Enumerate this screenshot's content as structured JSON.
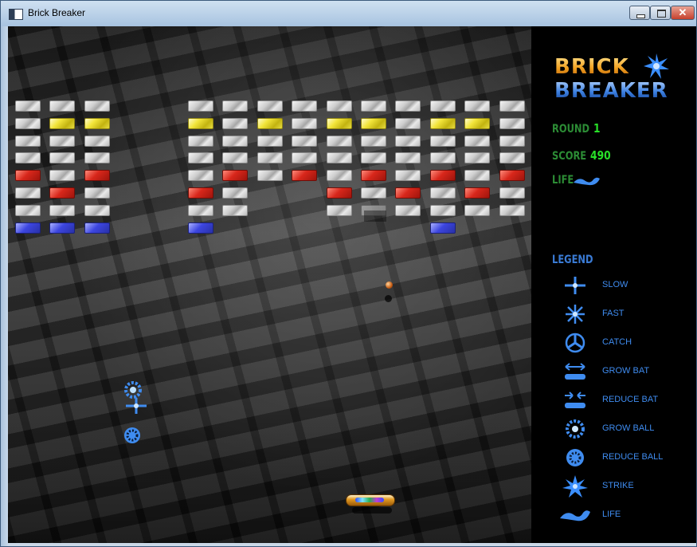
{
  "window": {
    "title": "Brick Breaker"
  },
  "logo": {
    "line1": "BRICK",
    "line2": "BREAKER"
  },
  "stats": {
    "round_label": "ROUND",
    "round_value": "1",
    "score_label": "SCORE",
    "score_value": "490",
    "life_label": "LIFE"
  },
  "legend": {
    "title": "LEGEND",
    "items": [
      {
        "icon": "slow-icon",
        "label": "SLOW"
      },
      {
        "icon": "fast-icon",
        "label": "FAST"
      },
      {
        "icon": "catch-icon",
        "label": "CATCH"
      },
      {
        "icon": "grow-bat-icon",
        "label": "GROW BAT"
      },
      {
        "icon": "reduce-bat-icon",
        "label": "REDUCE BAT"
      },
      {
        "icon": "grow-ball-icon",
        "label": "GROW BALL"
      },
      {
        "icon": "reduce-ball-icon",
        "label": "REDUCE BALL"
      },
      {
        "icon": "strike-icon",
        "label": "STRIKE"
      },
      {
        "icon": "life-icon",
        "label": "LIFE"
      }
    ]
  },
  "bricks": {
    "rows": [
      [
        "S",
        "S",
        "S",
        "-",
        "-",
        "S",
        "S",
        "S",
        "S",
        "S",
        "S",
        "S",
        "S",
        "S",
        "S"
      ],
      [
        "S",
        "Y",
        "Y",
        "-",
        "-",
        "Y",
        "S",
        "Y",
        "S",
        "Y",
        "Y",
        "S",
        "Y",
        "Y",
        "S"
      ],
      [
        "S",
        "S",
        "S",
        "-",
        "-",
        "S",
        "S",
        "S",
        "S",
        "S",
        "S",
        "S",
        "S",
        "S",
        "S"
      ],
      [
        "S",
        "S",
        "S",
        "-",
        "-",
        "S",
        "S",
        "S",
        "S",
        "S",
        "S",
        "S",
        "S",
        "S",
        "S"
      ],
      [
        "R",
        "S",
        "R",
        "-",
        "-",
        "S",
        "R",
        "S",
        "R",
        "S",
        "R",
        "S",
        "R",
        "S",
        "R"
      ],
      [
        "S",
        "R",
        "S",
        "-",
        "-",
        "R",
        "S",
        "-",
        "-",
        "R",
        "S",
        "R",
        "S",
        "R",
        "S"
      ],
      [
        "S",
        "S",
        "S",
        "-",
        "-",
        "S",
        "S",
        "-",
        "-",
        "S",
        "G",
        "S",
        "S",
        "S",
        "S"
      ],
      [
        "B",
        "B",
        "B",
        "-",
        "-",
        "B",
        "-",
        "-",
        "-",
        "-",
        "-",
        "-",
        "B",
        "-",
        "-"
      ]
    ],
    "legend_codes": {
      "S": "silver",
      "Y": "yellow",
      "R": "red",
      "B": "blue",
      "G": "gray"
    }
  },
  "colors": {
    "panel_background": "#000000",
    "legend_text": "#3f8cf0",
    "stat_label": "#2c8c35",
    "stat_value": "#28e028"
  }
}
